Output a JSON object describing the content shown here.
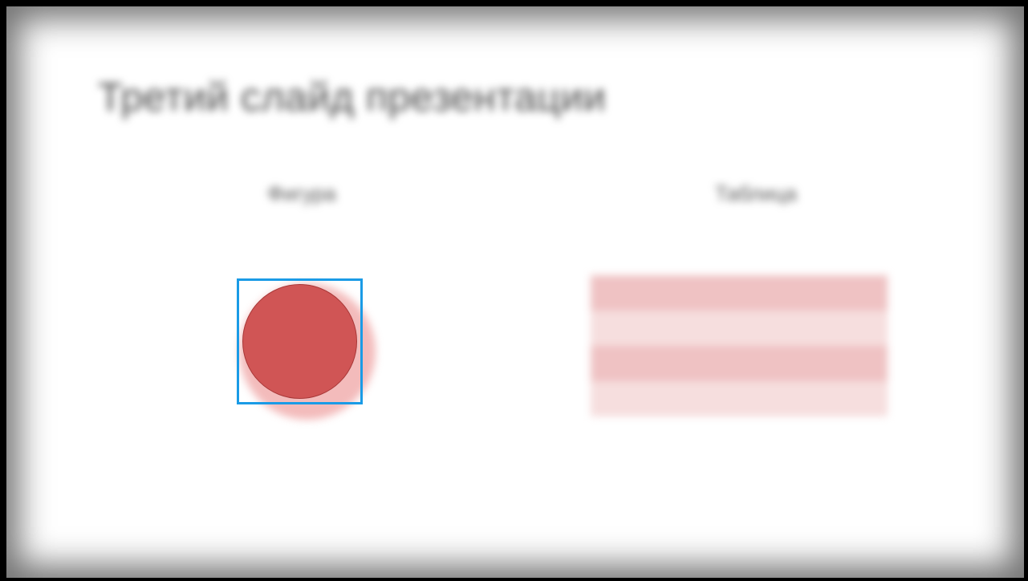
{
  "slide": {
    "title": "Третий слайд презентации",
    "left_column_label": "Фигура",
    "right_column_label": "Таблица"
  },
  "shape": {
    "type": "circle",
    "selected": true,
    "fill_color": "#d05555",
    "border_color": "#a83838",
    "selection_color": "#1a9be6"
  },
  "table": {
    "row_colors": [
      "#efc2c3",
      "#f6dede",
      "#efc2c3",
      "#f6dede"
    ]
  }
}
